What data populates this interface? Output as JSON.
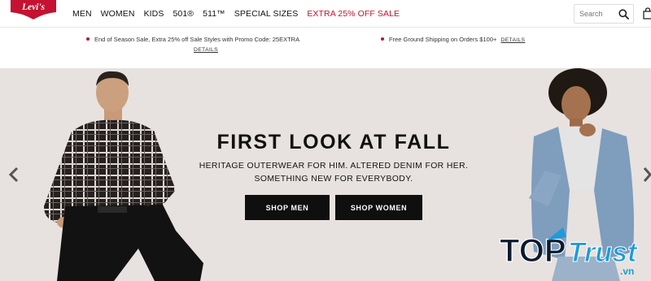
{
  "brand": {
    "logo_text": "Levi's",
    "color": "#c41230"
  },
  "nav": {
    "items": [
      {
        "label": "MEN"
      },
      {
        "label": "WOMEN"
      },
      {
        "label": "KIDS"
      },
      {
        "label": "501®"
      },
      {
        "label": "511™"
      },
      {
        "label": "SPECIAL SIZES"
      },
      {
        "label": "EXTRA 25% OFF SALE",
        "highlight": true
      }
    ]
  },
  "search": {
    "placeholder": "Search",
    "icon": "search-icon"
  },
  "cart": {
    "icon": "cart-icon"
  },
  "promos": [
    {
      "text": "End of Season Sale, Extra 25% off Sale Styles with Promo Code: 25EXTRA",
      "link": "DETAILS"
    },
    {
      "text": "Free Ground Shipping on Orders $100+",
      "link": "DETAILS"
    }
  ],
  "hero": {
    "title": "FIRST LOOK AT FALL",
    "subtitle_line1": "HERITAGE OUTERWEAR FOR HIM. ALTERED DENIM FOR HER.",
    "subtitle_line2": "SOMETHING NEW FOR EVERYBODY.",
    "buttons": {
      "men": "SHOP MEN",
      "women": "SHOP WOMEN"
    }
  },
  "watermark": {
    "part1": "TOP",
    "part2": "Trust",
    "suffix": ".vn"
  },
  "colors": {
    "accent": "#c41230",
    "hero_bg": "#e7e2df",
    "button_bg": "#0f0f0f"
  }
}
